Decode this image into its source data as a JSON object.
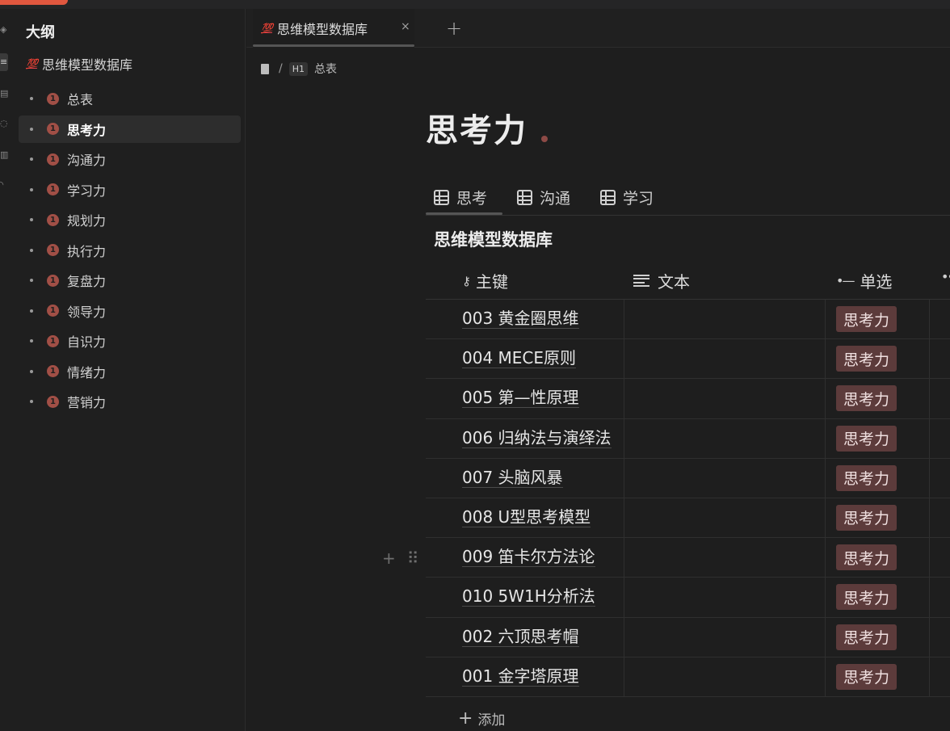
{
  "sidebar": {
    "title": "大纲",
    "root": {
      "emoji": "💯",
      "label": "思维模型数据库"
    },
    "items": [
      {
        "label": "总表",
        "badge": "1"
      },
      {
        "label": "思考力",
        "badge": "1",
        "active": true
      },
      {
        "label": "沟通力",
        "badge": "1"
      },
      {
        "label": "学习力",
        "badge": "1"
      },
      {
        "label": "规划力",
        "badge": "1"
      },
      {
        "label": "执行力",
        "badge": "1"
      },
      {
        "label": "复盘力",
        "badge": "1"
      },
      {
        "label": "领导力",
        "badge": "1"
      },
      {
        "label": "自识力",
        "badge": "1"
      },
      {
        "label": "情绪力",
        "badge": "1"
      },
      {
        "label": "营销力",
        "badge": "1"
      }
    ]
  },
  "tabbar": {
    "tab": {
      "emoji": "💯",
      "label": "思维模型数据库",
      "close": "×"
    },
    "add": "+"
  },
  "breadcrumb": {
    "separator": "/",
    "heading_badge": "H1",
    "heading": "总表"
  },
  "page": {
    "title": "思考力"
  },
  "views": [
    {
      "label": "思考"
    },
    {
      "label": "沟通"
    },
    {
      "label": "学习"
    }
  ],
  "database": {
    "title": "思维模型数据库",
    "columns": {
      "key": "主键",
      "text": "文本",
      "select": "单选"
    },
    "rows": [
      {
        "key": "003 黄金圈思维",
        "text": "",
        "select": "思考力"
      },
      {
        "key": "004 MECE原则",
        "text": "",
        "select": "思考力"
      },
      {
        "key": "005 第—性原理",
        "text": "",
        "select": "思考力"
      },
      {
        "key": "006 归纳法与演绎法",
        "text": "",
        "select": "思考力"
      },
      {
        "key": "007 头脑风暴",
        "text": "",
        "select": "思考力"
      },
      {
        "key": "008 U型思考模型",
        "text": "",
        "select": "思考力"
      },
      {
        "key": "009 笛卡尔方法论",
        "text": "",
        "select": "思考力"
      },
      {
        "key": "010 5W1H分析法",
        "text": "",
        "select": "思考力"
      },
      {
        "key": "002 六顶思考帽",
        "text": "",
        "select": "思考力"
      },
      {
        "key": "001 金字塔原理",
        "text": "",
        "select": "思考力"
      }
    ],
    "add_label": "添加"
  },
  "colors": {
    "accent": "#e0573f",
    "badge": "#a14f46",
    "select_tag": "#5c3b3b"
  }
}
